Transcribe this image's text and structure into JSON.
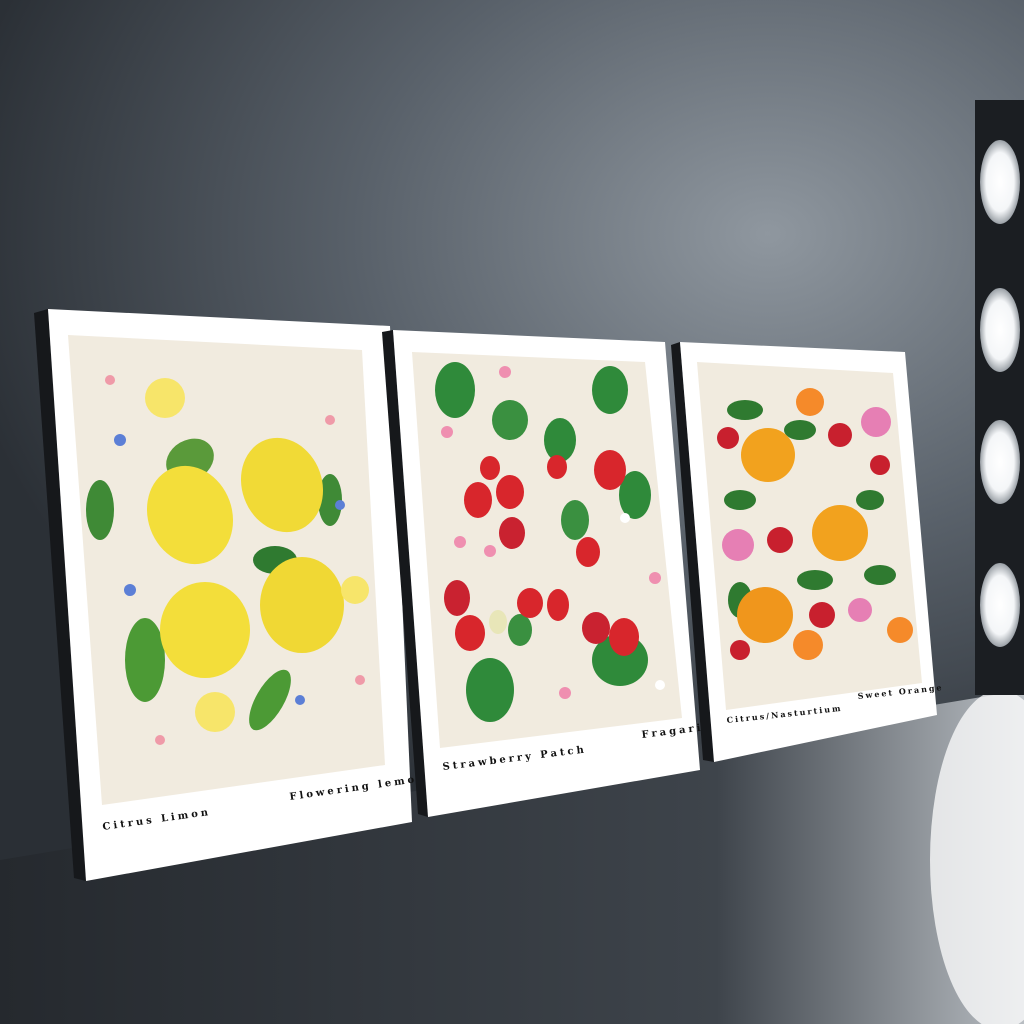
{
  "prints": [
    {
      "title": "Citrus Limon",
      "subtitle": "Flowering lemons",
      "fruit_color": "#f3de3a"
    },
    {
      "title": "Strawberry Patch",
      "subtitle": "Fragaria",
      "fruit_color": "#d8262c"
    },
    {
      "title": "Citrus/Nasturtium",
      "subtitle": "Sweet Orange",
      "fruit_color": "#f2a21e"
    }
  ],
  "colors": {
    "wall": "#4a5158",
    "floor": "#2f3338",
    "paper": "#f1ebdf",
    "leaf": "#2f8a3a"
  }
}
